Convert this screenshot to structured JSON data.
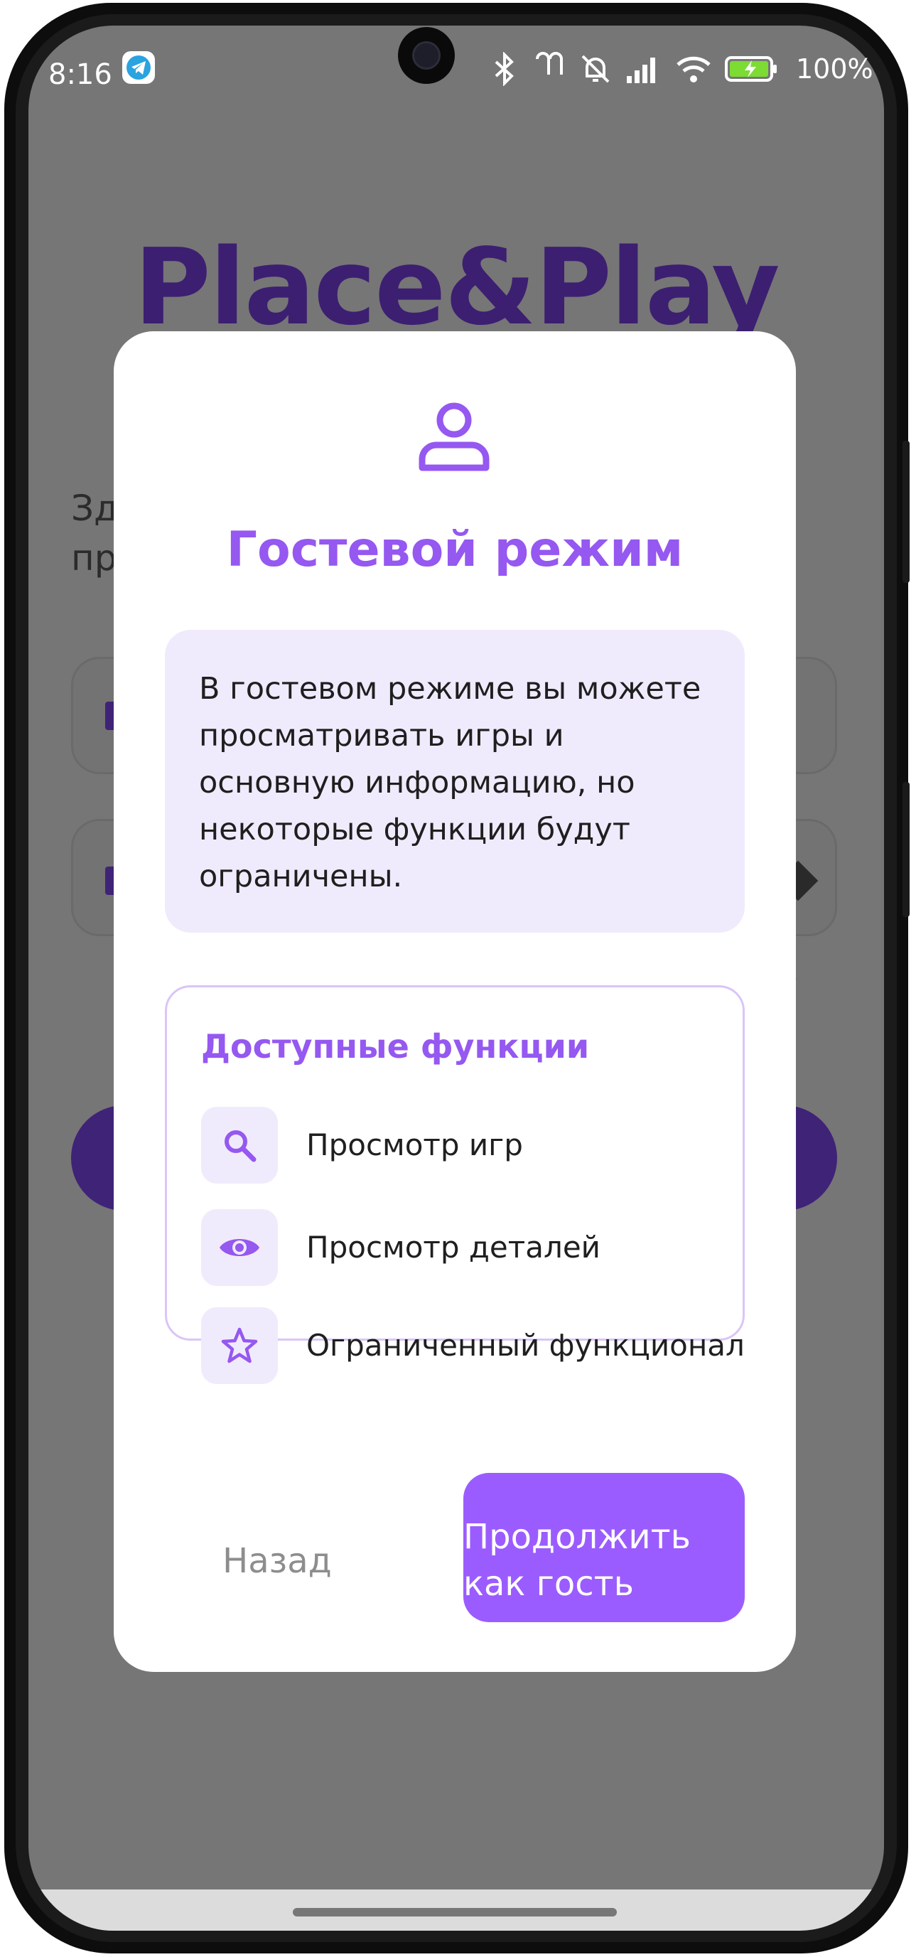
{
  "status_bar": {
    "time": "8:16",
    "battery": "100%",
    "icons": [
      "telegram-icon",
      "bluetooth-icon",
      "earbuds-icon",
      "mute-icon",
      "signal-icon",
      "wifi-icon",
      "battery-charging-icon"
    ]
  },
  "background": {
    "logo": "Place&Play",
    "text_line1": "Зд",
    "text_line2": "пр",
    "link_fragment": "?"
  },
  "dialog": {
    "icon": "user-icon",
    "title": "Гостевой режим",
    "info_text": "В гостевом режиме вы можете просматривать игры и основную информацию, но некоторые функции будут ограничены.",
    "features_title": "Доступные функции",
    "features": [
      {
        "icon": "search-icon",
        "label": "Просмотр игр"
      },
      {
        "icon": "eye-icon",
        "label": "Просмотр деталей"
      },
      {
        "icon": "star-icon",
        "label": "Ограниченный функционал"
      }
    ],
    "back_label": "Назад",
    "continue_label": "Продолжить как гость"
  },
  "colors": {
    "accent": "#9558f0",
    "button": "#9b5cff",
    "info_bg": "#f0ebfc",
    "scrim": "#767676",
    "brand_dark": "#3c1f71"
  }
}
